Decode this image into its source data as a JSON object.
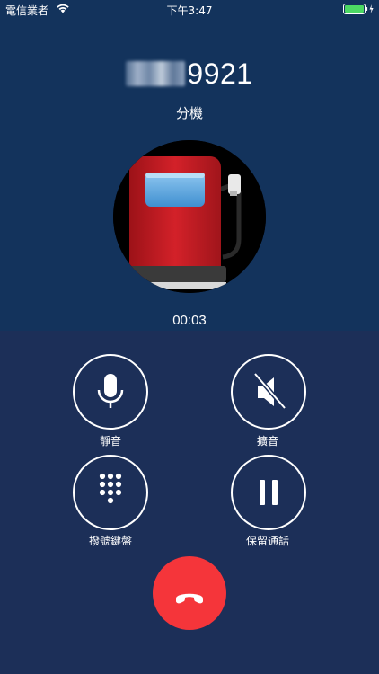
{
  "status_bar": {
    "carrier": "電信業者",
    "time": "下午3:47"
  },
  "caller": {
    "number_visible": "9921",
    "label": "分機"
  },
  "call": {
    "timer": "00:03"
  },
  "controls": {
    "mute_label": "靜音",
    "speaker_label": "擴音",
    "keypad_label": "撥號鍵盤",
    "hold_label": "保留通話"
  },
  "colors": {
    "top_background": "#13335c",
    "bottom_background": "#1c2f58",
    "end_call": "#f5353a",
    "battery": "#4cd964"
  },
  "icons": [
    "wifi-icon",
    "battery-icon",
    "microphone-icon",
    "speaker-muted-icon",
    "keypad-icon",
    "pause-icon",
    "phone-hangup-icon"
  ]
}
